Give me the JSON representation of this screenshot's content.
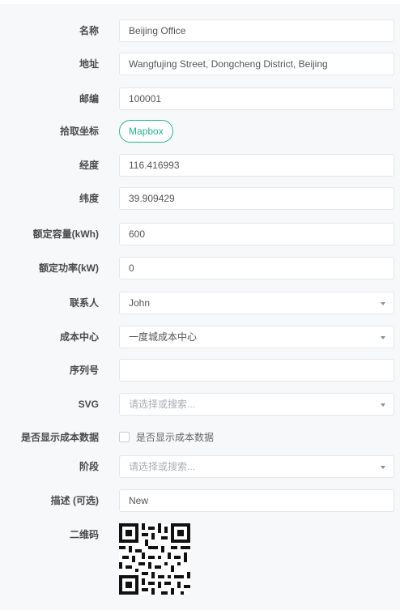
{
  "form": {
    "name": {
      "label": "名称",
      "value": "Beijing Office"
    },
    "address": {
      "label": "地址",
      "value": "Wangfujing Street, Dongcheng District, Beijing"
    },
    "postcode": {
      "label": "邮编",
      "value": "100001"
    },
    "pick_coords": {
      "label": "拾取坐标",
      "button": "Mapbox"
    },
    "longitude": {
      "label": "经度",
      "value": "116.416993"
    },
    "latitude": {
      "label": "纬度",
      "value": "39.909429"
    },
    "rated_capacity": {
      "label": "额定容量(kWh)",
      "value": "600"
    },
    "rated_power": {
      "label": "额定功率(kW)",
      "value": "0"
    },
    "contact": {
      "label": "联系人",
      "value": "John"
    },
    "cost_center": {
      "label": "成本中心",
      "value": "一度城成本中心"
    },
    "serial": {
      "label": "序列号",
      "value": ""
    },
    "svg": {
      "label": "SVG",
      "placeholder": "请选择或搜索..."
    },
    "show_cost": {
      "label": "是否显示成本数据",
      "checkbox_label": "是否显示成本数据",
      "checked": false
    },
    "stage": {
      "label": "阶段",
      "placeholder": "请选择或搜索..."
    },
    "description": {
      "label": "描述 (可选)",
      "value": "New"
    },
    "qrcode": {
      "label": "二维码",
      "icon": "qr-code-icon"
    }
  },
  "colors": {
    "accent": "#20b58a",
    "border": "#e4e6ea",
    "background": "#f7f8fa"
  }
}
